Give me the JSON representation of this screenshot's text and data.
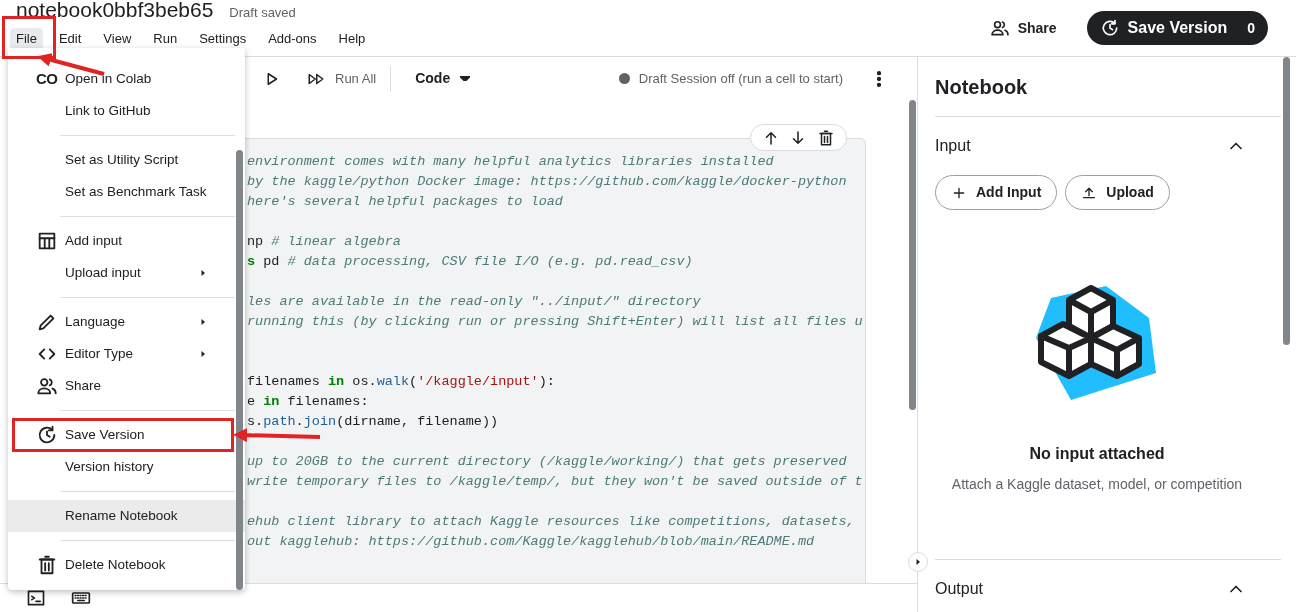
{
  "title": "notebook0bbf3beb65",
  "save_status": "Draft saved",
  "menubar": [
    {
      "label": "File",
      "selected": true
    },
    {
      "label": "Edit",
      "selected": false
    },
    {
      "label": "View",
      "selected": false
    },
    {
      "label": "Run",
      "selected": false
    },
    {
      "label": "Settings",
      "selected": false
    },
    {
      "label": "Add-ons",
      "selected": false
    },
    {
      "label": "Help",
      "selected": false
    }
  ],
  "header_actions": {
    "share": "Share",
    "save_version": "Save Version",
    "version_count": "0"
  },
  "file_menu": [
    {
      "kind": "item",
      "label": "Open in Colab",
      "icon_text": "CO",
      "submenu": false,
      "highlighted": false
    },
    {
      "kind": "item",
      "label": "Link to GitHub",
      "submenu": false,
      "highlighted": false
    },
    {
      "kind": "divider"
    },
    {
      "kind": "item",
      "label": "Set as Utility Script",
      "submenu": false,
      "highlighted": false
    },
    {
      "kind": "item",
      "label": "Set as Benchmark Task",
      "submenu": false,
      "highlighted": false
    },
    {
      "kind": "divider"
    },
    {
      "kind": "item",
      "label": "Add input",
      "submenu": false,
      "highlighted": false
    },
    {
      "kind": "item",
      "label": "Upload input",
      "submenu": true,
      "highlighted": false
    },
    {
      "kind": "divider"
    },
    {
      "kind": "item",
      "label": "Language",
      "submenu": true,
      "highlighted": false
    },
    {
      "kind": "item",
      "label": "Editor Type",
      "submenu": true,
      "highlighted": false
    },
    {
      "kind": "item",
      "label": "Share",
      "submenu": false,
      "highlighted": false
    },
    {
      "kind": "divider"
    },
    {
      "kind": "item",
      "label": "Save Version",
      "submenu": false,
      "highlighted": false
    },
    {
      "kind": "item",
      "label": "Version history",
      "submenu": false,
      "highlighted": false
    },
    {
      "kind": "divider"
    },
    {
      "kind": "item",
      "label": "Rename Notebook",
      "submenu": false,
      "highlighted": true
    },
    {
      "kind": "divider"
    },
    {
      "kind": "item",
      "label": "Delete Notebook",
      "submenu": false,
      "highlighted": false
    }
  ],
  "toolbar": {
    "run_all": "Run All",
    "cell_type": "Code",
    "session_status": "Draft Session off (run a cell to start)"
  },
  "code_lines": [
    {
      "kind": "code",
      "segments": [
        {
          "text": "environment comes with many helpful analytics libraries installed",
          "kind": "comment"
        }
      ]
    },
    {
      "kind": "code",
      "segments": [
        {
          "text": "by the kaggle/python Docker image: https://github.com/kaggle/docker-python",
          "kind": "comment"
        }
      ]
    },
    {
      "kind": "code",
      "segments": [
        {
          "text": "here's several helpful packages to load",
          "kind": "comment"
        }
      ]
    },
    {
      "kind": "blank"
    },
    {
      "kind": "code",
      "segments": [
        {
          "text": "np ",
          "kind": "plain"
        },
        {
          "text": "# linear algebra",
          "kind": "comment"
        }
      ]
    },
    {
      "kind": "code",
      "segments": [
        {
          "text": "s",
          "kind": "keyword"
        },
        {
          "text": " pd ",
          "kind": "plain"
        },
        {
          "text": "# data processing, CSV file I/O (e.g. pd.read_csv)",
          "kind": "comment"
        }
      ]
    },
    {
      "kind": "blank"
    },
    {
      "kind": "code",
      "segments": [
        {
          "text": "les are available in the read-only \"../input/\" directory",
          "kind": "comment"
        }
      ]
    },
    {
      "kind": "code",
      "segments": [
        {
          "text": "running this (by clicking run or pressing Shift+Enter) will list all files u",
          "kind": "comment"
        }
      ]
    },
    {
      "kind": "blank"
    },
    {
      "kind": "blank"
    },
    {
      "kind": "code",
      "segments": [
        {
          "text": "filenames ",
          "kind": "plain"
        },
        {
          "text": "in",
          "kind": "keyword"
        },
        {
          "text": " os.",
          "kind": "plain"
        },
        {
          "text": "walk",
          "kind": "builtin"
        },
        {
          "text": "(",
          "kind": "plain"
        },
        {
          "text": "'/kaggle/input'",
          "kind": "string"
        },
        {
          "text": "):",
          "kind": "plain"
        }
      ]
    },
    {
      "kind": "code",
      "segments": [
        {
          "text": "e ",
          "kind": "plain"
        },
        {
          "text": "in",
          "kind": "keyword"
        },
        {
          "text": " filenames:",
          "kind": "plain"
        }
      ]
    },
    {
      "kind": "code",
      "segments": [
        {
          "text": "s.",
          "kind": "plain"
        },
        {
          "text": "path",
          "kind": "builtin"
        },
        {
          "text": ".",
          "kind": "plain"
        },
        {
          "text": "join",
          "kind": "builtin"
        },
        {
          "text": "(dirname, filename))",
          "kind": "plain"
        }
      ]
    },
    {
      "kind": "blank"
    },
    {
      "kind": "code",
      "segments": [
        {
          "text": "up to 20GB to the current directory (/kaggle/working/) that gets preserved",
          "kind": "comment"
        }
      ]
    },
    {
      "kind": "code",
      "segments": [
        {
          "text": "write temporary files to /kaggle/temp/, but they won't be saved outside of t",
          "kind": "comment"
        }
      ]
    },
    {
      "kind": "blank"
    },
    {
      "kind": "code",
      "segments": [
        {
          "text": "ehub client library to attach Kaggle resources like competitions, datasets,",
          "kind": "comment"
        }
      ]
    },
    {
      "kind": "code",
      "segments": [
        {
          "text": "out kagglehub: https://github.com/Kaggle/kagglehub/blob/main/README.md",
          "kind": "comment"
        }
      ]
    }
  ],
  "side_panel": {
    "title": "Notebook",
    "sections": [
      {
        "title": "Input",
        "expanded": true,
        "buttons": [
          {
            "kind": "add",
            "label": "Add Input"
          },
          {
            "kind": "upload",
            "label": "Upload"
          }
        ],
        "empty_title": "No input attached",
        "empty_text": "Attach a Kaggle dataset, model, or competition"
      },
      {
        "title": "Output",
        "expanded": true
      }
    ]
  }
}
